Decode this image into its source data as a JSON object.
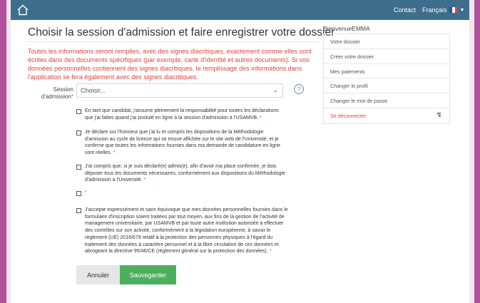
{
  "topbar": {
    "contact": "Contact",
    "language": "Français"
  },
  "title": "Choisir la session d'admission et faire enregistrer votre dossier",
  "info": "Toutes les informations seront remplies, avec des signes diacritiques, exactement comme elles sont écrites dans des documents spécifiques (par exemple, carte d'identité et autres documents). Si vos données personnelles contiennent des signes diacritiques, le remplissage des informations dans l'application se fera également avec des signes diacritiques.",
  "session_field": {
    "label": "Session d'admission",
    "required_mark": "*",
    "value": "Choisir..."
  },
  "checkboxes": [
    {
      "text": "En tant que candidat, j'assume pleinement la responsabilité pour toutes les déclarations que j'ai faites quand j'ai postulé en ligne à la session d'admission à l'USAMVB.",
      "required_mark": "*",
      "checked": false
    },
    {
      "text": "Je déclare sur l'honneur que j'ai lu et compris les dispositions de la Méthodologie d'amission au cycle de licence qui se trouve affichée sur le site web de l'Université, et je confirme que toutes les informations fournies dans ma demande de candidature en ligne sont réelles.",
      "required_mark": "*",
      "checked": false
    },
    {
      "text": "J'ai compris que, si je suis déclaré(e) admis(e), afin d'avoir ma place confirmée, je dois déposer tous les documents nécessaires, conformément aux dispositions du Méthodologie d'admission à l'Université.",
      "required_mark": "*",
      "checked": false
    },
    {
      "text": "",
      "required_mark": "*",
      "checked": false
    },
    {
      "text": "J'accepte expressément et sans équivoque que mes données personnelles fournies dans le formulaire d'inscription soient traitées par tout moyen, aux fins de la gestion de l'activité de management universitaire, par USAMVB et par toute autre institution autorisée à effectuer des contrôles sur son activité, conformément à la législation européenne, à savoir le règlement (UE) 2016/679 relatif à la protection des personnes physiques à l'égard du traitement des données à caractère personnel et à la libre circulation de ces données et abrogeant la directive 95/46/CE (règlement général sur la protection des données).",
      "required_mark": "*",
      "checked": false
    }
  ],
  "buttons": {
    "cancel": "Annuler",
    "save": "Sauvegarder"
  },
  "sidebar": {
    "welcome": "BienvenueEMMA",
    "items": [
      {
        "label": "Votre dossier"
      },
      {
        "label": "Créer votre dossier"
      },
      {
        "label": "Mes paiements"
      },
      {
        "label": "Changer le profil"
      },
      {
        "label": "Changer le mot de passe"
      },
      {
        "label": "Se déconnecter"
      }
    ]
  },
  "colors": {
    "topbar": "#3d6f8c",
    "frame": "#b0509a",
    "accent_red": "#e0443c",
    "save_green": "#4caf5d"
  },
  "icons": [
    "home-icon",
    "flag-fr-icon",
    "chevron-down-icon",
    "help-icon",
    "logout-icon"
  ]
}
